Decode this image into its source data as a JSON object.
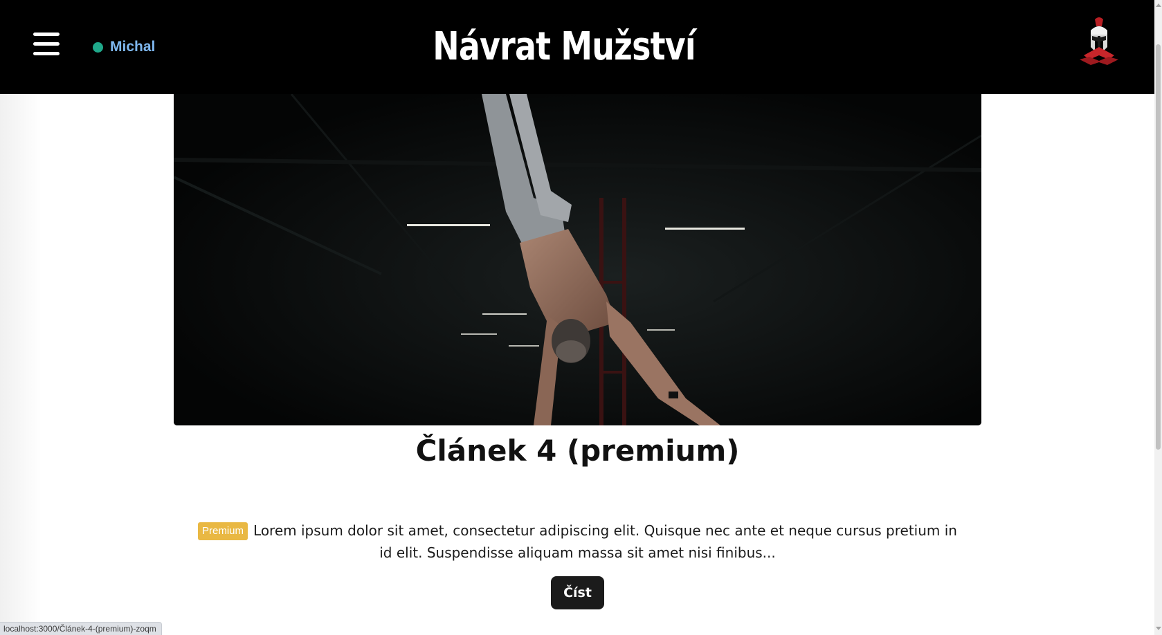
{
  "header": {
    "user_name": "Michal",
    "site_title": "Návrat Mužství"
  },
  "article": {
    "title": "Článek 4 (premium)",
    "badge": "Premium",
    "excerpt": "Lorem ipsum dolor sit amet, consectetur adipiscing elit. Quisque nec ante et neque cursus pretium in id elit. Suspendisse aliquam massa sit amet nisi finibus...",
    "read_button": "Číst"
  },
  "status_bar": {
    "url": "localhost:3000/Článek-4-(premium)-zoqm"
  },
  "icons": {
    "menu": "hamburger-menu-icon",
    "logo": "spartan-helmet-logo",
    "status": "online-status-dot"
  },
  "colors": {
    "header_bg": "#000000",
    "user_name": "#7fb8f0",
    "status_dot": "#1fa88a",
    "badge": "#e9b843",
    "button": "#1b1b1b"
  }
}
